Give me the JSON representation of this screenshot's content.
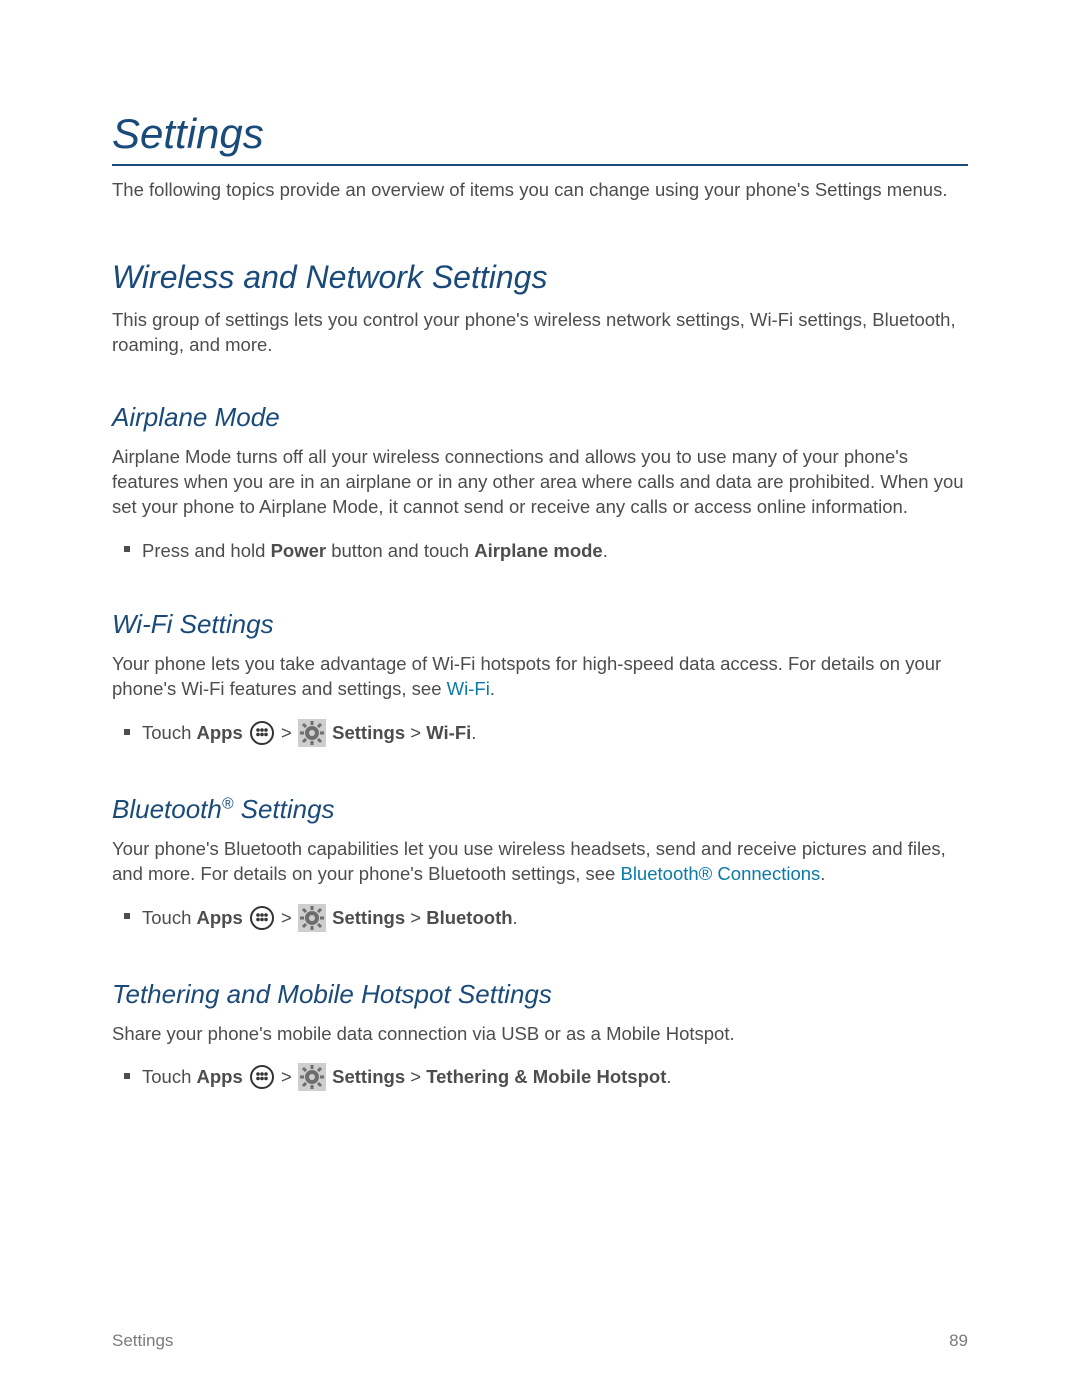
{
  "title": "Settings",
  "intro": "The following topics provide an overview of items you can change using your phone's Settings menus.",
  "section1": {
    "heading": "Wireless and Network Settings",
    "body": "This group of settings lets you control your phone's wireless network settings, Wi-Fi settings, Bluetooth, roaming, and more."
  },
  "airplane": {
    "heading": "Airplane Mode",
    "body": "Airplane Mode turns off all your wireless connections and allows you to use many of your phone's features when you are in an airplane or in any other area where calls and data are prohibited. When you set your phone to Airplane Mode, it cannot send or receive any calls or access online information.",
    "bullet_prefix": "Press and hold ",
    "bullet_bold1": "Power",
    "bullet_mid": " button and touch ",
    "bullet_bold2": "Airplane mode",
    "bullet_suffix": "."
  },
  "wifi": {
    "heading": "Wi-Fi Settings",
    "body_prefix": "Your phone lets you take advantage of Wi-Fi hotspots for high-speed data access. For details on your phone's Wi-Fi features and settings, see ",
    "link_text": "Wi-Fi",
    "body_suffix": ".",
    "bullet_touch": "Touch ",
    "bullet_apps": "Apps",
    "bullet_sep": " > ",
    "bullet_settings": "Settings",
    "bullet_target": "Wi-Fi",
    "bullet_end": "."
  },
  "bluetooth": {
    "heading_prefix": "Bluetooth",
    "heading_sup": "®",
    "heading_suffix": " Settings",
    "body_prefix": "Your phone's Bluetooth capabilities let you use wireless headsets, send and receive pictures and files, and more. For details on your phone's Bluetooth settings, see ",
    "link_text": "Bluetooth® Connections",
    "body_suffix": ".",
    "bullet_touch": "Touch ",
    "bullet_apps": "Apps",
    "bullet_sep": " > ",
    "bullet_settings": "Settings",
    "bullet_target": "Bluetooth",
    "bullet_end": "."
  },
  "tethering": {
    "heading": "Tethering and Mobile Hotspot Settings",
    "body": "Share your phone's mobile data connection via USB or as a Mobile Hotspot.",
    "bullet_touch": "Touch ",
    "bullet_apps": "Apps",
    "bullet_sep": " > ",
    "bullet_settings": "Settings",
    "bullet_target": "Tethering & Mobile Hotspot",
    "bullet_end": "."
  },
  "footer": {
    "label": "Settings",
    "page": "89"
  }
}
